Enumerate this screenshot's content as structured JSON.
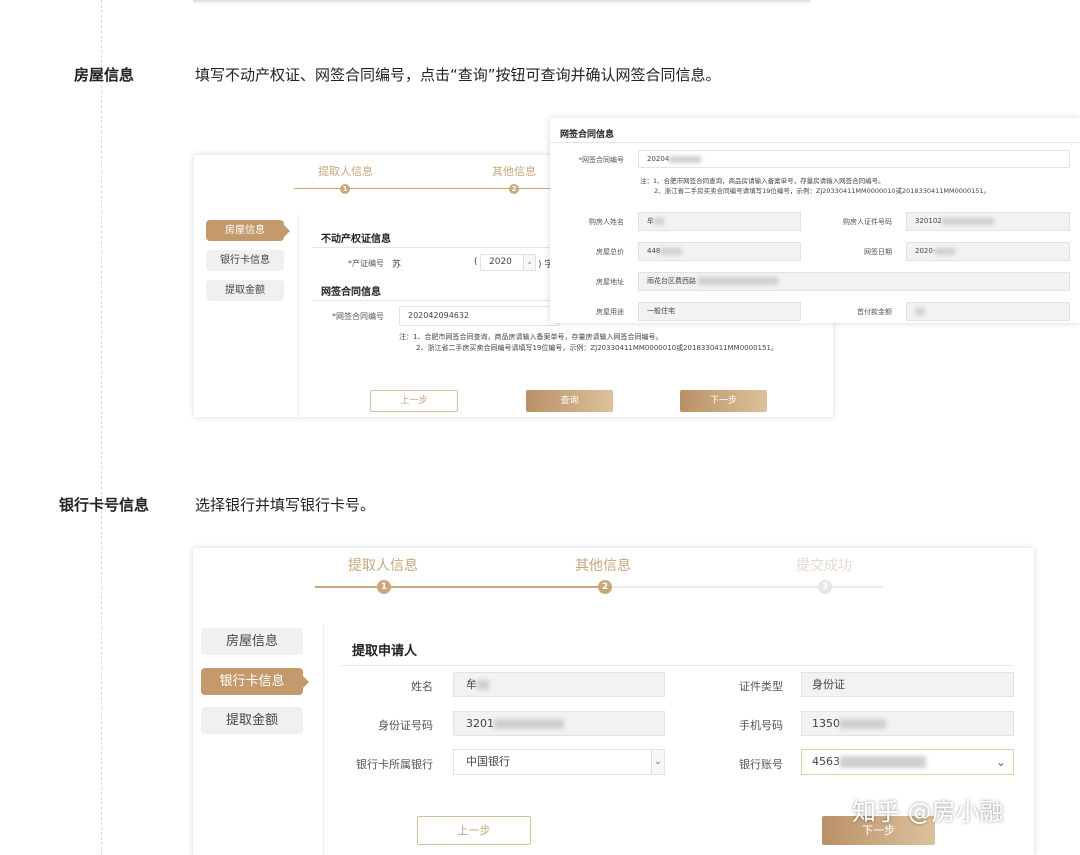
{
  "sections": [
    {
      "title": "房屋信息",
      "desc": "填写不动产权证、网签合同编号，点击“查询”按钮可查询并确认网签合同信息。"
    },
    {
      "title": "银行卡号信息",
      "desc": "选择银行并填写银行卡号。"
    }
  ],
  "steps": [
    "提取人信息",
    "其他信息",
    "提交成功"
  ],
  "step_numbers": [
    "1",
    "2",
    "3"
  ],
  "side_menu": [
    "房屋信息",
    "银行卡信息",
    "提取金额"
  ],
  "house_form": {
    "title1": "不动产权证信息",
    "cert_label": "*产证编号",
    "cert_value": "苏",
    "cert_paren_open": "(",
    "cert_year": "2020",
    "cert_paren_close": ") 字",
    "title2": "网签合同信息",
    "contract_label": "*网签合同编号",
    "contract_value": "202042094632",
    "note1": "注：1、合肥市网签合同查询，商品房请输入备案单号，存量房请输入网签合同编号。",
    "note2": "2、浙江省二手房买卖合同编号请填写19位编号，示例：ZJ20330411MM0000010或2018330411MM0000151。",
    "btn_prev": "上一步",
    "btn_query": "查询",
    "btn_next": "下一步"
  },
  "contract_popup": {
    "title": "网签合同信息",
    "contract_label": "*网签合同编号",
    "contract_value": "20204",
    "note1": "注：1、合肥市网签合同查询，商品房请输入备案单号，存量房请输入网签合同编号。",
    "note2": "2、浙江省二手房买卖合同编号请填写19位编号，示例：ZJ20330411MM0000010或2018330411MM0000151。",
    "buyer_name_label": "购房人姓名",
    "buyer_name_value": "牟",
    "buyer_id_label": "购房人证件号码",
    "buyer_id_value": "320102",
    "total_price_label": "房屋总价",
    "total_price_value": "448",
    "sign_date_label": "网签日期",
    "sign_date_value": "2020-",
    "address_label": "房屋地址",
    "address_value": "雨花台区费西路",
    "usage_label": "房屋用途",
    "usage_value": "一般住宅",
    "down_payment_label": "首付款金额",
    "down_payment_value": ""
  },
  "bank_form": {
    "section_title": "提取申请人",
    "name_label": "姓名",
    "name_value": "牟",
    "id_type_label": "证件类型",
    "id_type_value": "身份证",
    "id_no_label": "身份证号码",
    "id_no_value": "3201",
    "phone_label": "手机号码",
    "phone_value": "1350",
    "bank_label": "银行卡所属银行",
    "bank_value": "中国银行",
    "account_label": "银行账号",
    "account_value": "4563",
    "btn_prev": "上一步",
    "btn_next": "下一步"
  },
  "watermark": "知乎 @房小融",
  "colors": {
    "gold": "#c9a77c",
    "gold_dark": "#b99067",
    "required": "#e04b4b"
  }
}
